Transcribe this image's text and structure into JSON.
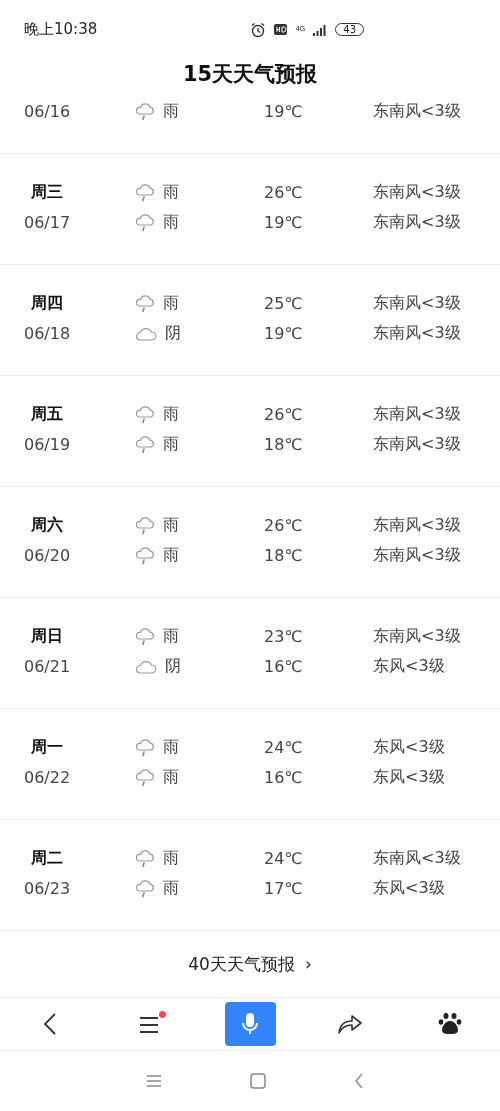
{
  "status_bar": {
    "time": "晚上10:38",
    "network": "4G",
    "battery": "43"
  },
  "title": "15天天气预报",
  "days": [
    {
      "date": "06/16",
      "night": {
        "kind": "rain",
        "weather": "雨",
        "temp": "19℃",
        "wind": "东南风<3级"
      }
    },
    {
      "weekday": "周三",
      "date": "06/17",
      "day": {
        "kind": "rain",
        "weather": "雨",
        "temp": "26℃",
        "wind": "东南风<3级"
      },
      "night": {
        "kind": "rain",
        "weather": "雨",
        "temp": "19℃",
        "wind": "东南风<3级"
      }
    },
    {
      "weekday": "周四",
      "date": "06/18",
      "day": {
        "kind": "rain",
        "weather": "雨",
        "temp": "25℃",
        "wind": "东南风<3级"
      },
      "night": {
        "kind": "overcast",
        "weather": "阴",
        "temp": "19℃",
        "wind": "东南风<3级"
      }
    },
    {
      "weekday": "周五",
      "date": "06/19",
      "day": {
        "kind": "rain",
        "weather": "雨",
        "temp": "26℃",
        "wind": "东南风<3级"
      },
      "night": {
        "kind": "rain",
        "weather": "雨",
        "temp": "18℃",
        "wind": "东南风<3级"
      }
    },
    {
      "weekday": "周六",
      "date": "06/20",
      "day": {
        "kind": "rain",
        "weather": "雨",
        "temp": "26℃",
        "wind": "东南风<3级"
      },
      "night": {
        "kind": "rain",
        "weather": "雨",
        "temp": "18℃",
        "wind": "东南风<3级"
      }
    },
    {
      "weekday": "周日",
      "date": "06/21",
      "day": {
        "kind": "rain",
        "weather": "雨",
        "temp": "23℃",
        "wind": "东南风<3级"
      },
      "night": {
        "kind": "overcast",
        "weather": "阴",
        "temp": "16℃",
        "wind": "东风<3级"
      }
    },
    {
      "weekday": "周一",
      "date": "06/22",
      "day": {
        "kind": "rain",
        "weather": "雨",
        "temp": "24℃",
        "wind": "东风<3级"
      },
      "night": {
        "kind": "rain",
        "weather": "雨",
        "temp": "16℃",
        "wind": "东风<3级"
      }
    },
    {
      "weekday": "周二",
      "date": "06/23",
      "day": {
        "kind": "rain",
        "weather": "雨",
        "temp": "24℃",
        "wind": "东南风<3级"
      },
      "night": {
        "kind": "rain",
        "weather": "雨",
        "temp": "17℃",
        "wind": "东风<3级"
      }
    }
  ],
  "more_link": {
    "label": "40天天气预报",
    "arrow": "›"
  },
  "toolbar": {
    "menu_badge": true
  }
}
